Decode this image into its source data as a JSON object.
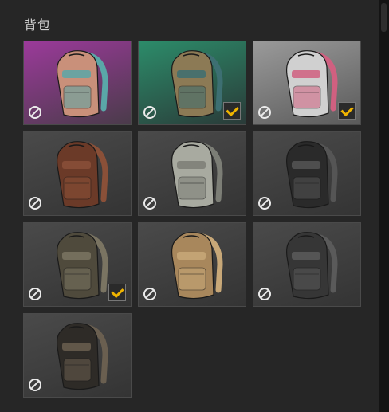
{
  "header": {
    "title": "背包"
  },
  "items": [
    {
      "name": "floral-backpack-pink",
      "bg": [
        "#9b3a9a",
        "#4a3b4a"
      ],
      "body": "#c9907a",
      "accent": "#5aa7a8",
      "selected": false
    },
    {
      "name": "floral-backpack-teal",
      "bg": [
        "#2c8c6a",
        "#2a3a38"
      ],
      "body": "#8c7a55",
      "accent": "#3d6f72",
      "selected": true
    },
    {
      "name": "white-backpack",
      "bg": [
        "#9a9a9a",
        "#5a5a5a"
      ],
      "body": "#d0d0d0",
      "accent": "#d06080",
      "selected": true
    },
    {
      "name": "brown-leather-backpack",
      "bg": [
        "#4a4a4a",
        "#343434"
      ],
      "body": "#6b3a28",
      "accent": "#8a5038",
      "selected": false
    },
    {
      "name": "light-gray-hydration-pack",
      "bg": [
        "#4a4a4a",
        "#343434"
      ],
      "body": "#a8aaa0",
      "accent": "#7c7e76",
      "selected": false
    },
    {
      "name": "black-tactical-backpack",
      "bg": [
        "#4a4a4a",
        "#343434"
      ],
      "body": "#2a2a2a",
      "accent": "#555555",
      "selected": false
    },
    {
      "name": "camo-tactical-backpack",
      "bg": [
        "#4a4a4a",
        "#343434"
      ],
      "body": "#4f4a3c",
      "accent": "#7a7462",
      "selected": true
    },
    {
      "name": "tan-backpack",
      "bg": [
        "#4a4a4a",
        "#343434"
      ],
      "body": "#a8875c",
      "accent": "#c8a878",
      "selected": false
    },
    {
      "name": "dark-gray-backpack",
      "bg": [
        "#4a4a4a",
        "#343434"
      ],
      "body": "#363636",
      "accent": "#5a5a5a",
      "selected": false
    },
    {
      "name": "dark-camo-backpack",
      "bg": [
        "#4a4a4a",
        "#343434"
      ],
      "body": "#2e2b27",
      "accent": "#6a5f50",
      "selected": false
    }
  ]
}
